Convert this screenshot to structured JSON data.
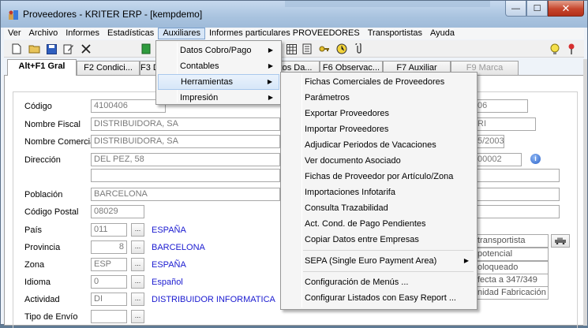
{
  "window": {
    "title": "Proveedores - KRITER ERP - [kempdemo]",
    "min_label": "—",
    "max_label": "☐",
    "close_label": "✕"
  },
  "menubar": [
    "Ver",
    "Archivo",
    "Informes",
    "Estadísticas",
    "Auxiliares",
    "Informes particulares PROVEEDORES",
    "Transportistas",
    "Ayuda"
  ],
  "toolbar_icons": [
    "new-doc-icon",
    "open-folder-icon",
    "save-icon",
    "edit-icon",
    "delete-icon",
    "green-book-icon"
  ],
  "tabs": [
    {
      "label": "Alt+F1 Gral",
      "active": true
    },
    {
      "label": "F2 Condici..."
    },
    {
      "label": "F3 D"
    },
    {
      "label": "tos Da..."
    },
    {
      "label": "F6 Observac..."
    },
    {
      "label": "F7 Auxiliar"
    },
    {
      "label": "F9 Marca",
      "disabled": true
    }
  ],
  "form": {
    "codigo_label": "Código",
    "codigo_value": "4100406",
    "nombre_fiscal_label": "Nombre Fiscal",
    "nombre_fiscal_value": "DISTRIBUIDORA, SA",
    "nombre_comercial_label": "Nombre Comercial",
    "nombre_comercial_value": "DISTRIBUIDORA, SA",
    "direccion_label": "Dirección",
    "direccion_value": "DEL PEZ, 58",
    "poblacion_label": "Población",
    "poblacion_value": "BARCELONA",
    "codigo_postal_label": "Código Postal",
    "codigo_postal_value": "08029",
    "pais_label": "País",
    "pais_code": "011",
    "pais_name": "ESPAÑA",
    "provincia_label": "Provincia",
    "provincia_code": "8",
    "provincia_name": "BARCELONA",
    "zona_label": "Zona",
    "zona_code": "ESP",
    "zona_name": "ESPAÑA",
    "idioma_label": "Idioma",
    "idioma_code": "0",
    "idioma_name": "Español",
    "actividad_label": "Actividad",
    "actividad_code": "DI",
    "actividad_name": "DISTRIBUIDOR INFORMATICA",
    "tipo_envio_label": "Tipo de Envío",
    "lookup_label": "...",
    "right_partial": [
      "06",
      "RI",
      "5/2003",
      "00002"
    ],
    "right_checks": [
      "transportista",
      "potencial",
      "oloqueado",
      "fecta a 347/349",
      "nidad Fabricación"
    ]
  },
  "auxiliares_menu": [
    "Datos Cobro/Pago",
    "Contables",
    "Herramientas",
    "Impresión"
  ],
  "herramientas_menu": [
    "Fichas Comerciales de Proveedores",
    "Parámetros",
    "Exportar Proveedores",
    "Importar Proveedores",
    "Adjudicar Periodos de Vacaciones",
    "Ver documento Asociado",
    "Fichas de Proveedor por Artículo/Zona",
    "Importaciones Infotarifa",
    "Consulta Trazabilidad",
    "Act. Cond. de Pago Pendientes",
    "Copiar Datos entre Empresas",
    "SEPA (Single Euro Payment Area)",
    "Configuración de Menús ...",
    "Configurar Listados con Easy Report ..."
  ],
  "colors": {
    "link": "#1a1ad0",
    "highlight": "#d6e6f8",
    "close": "#c6452c"
  }
}
